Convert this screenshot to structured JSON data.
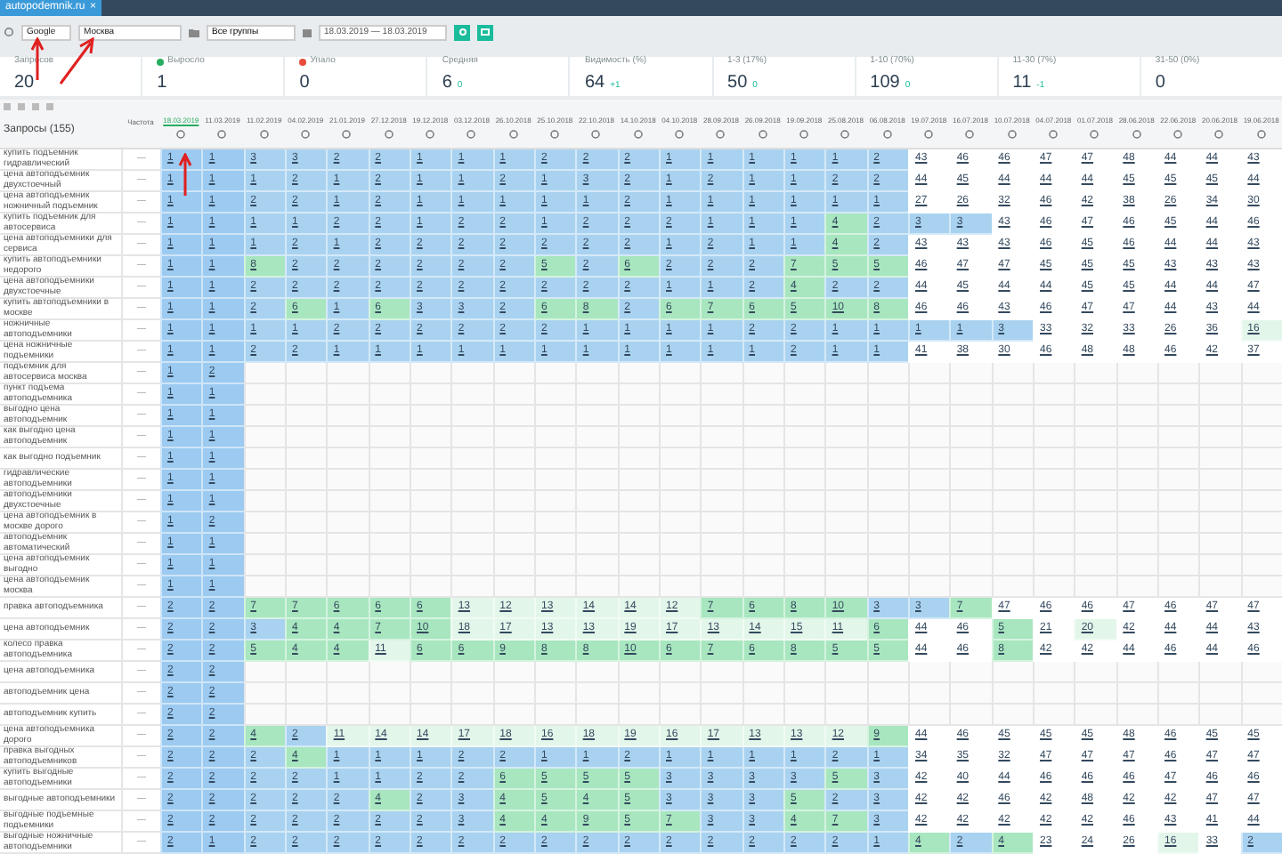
{
  "tab": {
    "label": "autopodemnik.ru",
    "close": "×"
  },
  "filters": {
    "engine": "Google",
    "region": "Москва",
    "group": "Все группы",
    "period": "18.03.2019 — 18.03.2019"
  },
  "stats": [
    {
      "label": "Запросов",
      "value": "20",
      "kind": "plain"
    },
    {
      "label": "Выросло",
      "value": "1",
      "kind": "up"
    },
    {
      "label": "Упало",
      "value": "0",
      "kind": "down"
    },
    {
      "label": "Средняя",
      "value": "6",
      "delta": "0",
      "kind": "metric"
    },
    {
      "label": "Видимость (%)",
      "value": "64",
      "delta": "+1",
      "kind": "metric"
    },
    {
      "label": "1-3 (17%)",
      "value": "50",
      "delta": "0",
      "kind": "metric"
    },
    {
      "label": "1-10 (70%)",
      "value": "109",
      "delta": "0",
      "kind": "metric"
    },
    {
      "label": "11-30 (7%)",
      "value": "11",
      "delta": "-1",
      "kind": "metric"
    },
    {
      "label": "31-50 (0%)",
      "value": "0",
      "kind": "plain"
    }
  ],
  "table": {
    "query_header": "Запросы (155)",
    "frequency_header": "Частота",
    "dates": [
      {
        "label": "18.03.2019",
        "current": true
      },
      {
        "label": "11.03.2019",
        "current": false
      },
      {
        "label": "11.02.2019",
        "current": false
      },
      {
        "label": "04.02.2019",
        "current": false
      },
      {
        "label": "21.01.2019",
        "current": false
      },
      {
        "label": "27.12.2018",
        "current": false
      },
      {
        "label": "19.12.2018",
        "current": false
      },
      {
        "label": "03.12.2018",
        "current": false
      },
      {
        "label": "26.10.2018",
        "current": false
      },
      {
        "label": "25.10.2018",
        "current": false
      },
      {
        "label": "22.10.2018",
        "current": false
      },
      {
        "label": "14.10.2018",
        "current": false
      },
      {
        "label": "04.10.2018",
        "current": false
      },
      {
        "label": "28.09.2018",
        "current": false
      },
      {
        "label": "26.09.2018",
        "current": false
      },
      {
        "label": "19.09.2018",
        "current": false
      },
      {
        "label": "25.08.2018",
        "current": false
      },
      {
        "label": "06.08.2018",
        "current": false
      },
      {
        "label": "19.07.2018",
        "current": false
      },
      {
        "label": "16.07.2018",
        "current": false
      },
      {
        "label": "10.07.2018",
        "current": false
      },
      {
        "label": "04.07.2018",
        "current": false
      },
      {
        "label": "01.07.2018",
        "current": false
      },
      {
        "label": "28.06.2018",
        "current": false
      },
      {
        "label": "22.06.2018",
        "current": false
      },
      {
        "label": "20.06.2018",
        "current": false
      },
      {
        "label": "19.06.2018",
        "current": false
      }
    ],
    "rows": [
      {
        "query": "купить подъемник гидравлический",
        "frequency": "—",
        "cells": [
          "1",
          "1",
          "3",
          "3",
          "2",
          "2",
          "1",
          "1",
          "1",
          "2",
          "2",
          "2",
          "1",
          "1",
          "1",
          "1",
          "1",
          "2",
          "43",
          "46",
          "46",
          "47",
          "47",
          "48",
          "44",
          "44",
          "43"
        ]
      },
      {
        "query": "цена автоподъемник двухстоечный",
        "frequency": "—",
        "cells": [
          "1",
          "1",
          "1",
          "2",
          "1",
          "2",
          "1",
          "1",
          "2",
          "1",
          "3",
          "2",
          "1",
          "2",
          "1",
          "1",
          "2",
          "2",
          "44",
          "45",
          "44",
          "44",
          "44",
          "45",
          "45",
          "45",
          "44"
        ]
      },
      {
        "query": "цена автоподъемник ножничный подъемник",
        "frequency": "—",
        "cells": [
          "1",
          "1",
          "2",
          "2",
          "1",
          "2",
          "1",
          "1",
          "1",
          "1",
          "1",
          "2",
          "1",
          "1",
          "1",
          "1",
          "1",
          "1",
          "27",
          "26",
          "32",
          "46",
          "42",
          "38",
          "26",
          "34",
          "30"
        ]
      },
      {
        "query": "купить подъемник для автосервиса",
        "frequency": "—",
        "cells": [
          "1",
          "1",
          "1",
          "1",
          "2",
          "2",
          "1",
          "2",
          "2",
          "1",
          "2",
          "2",
          "2",
          "1",
          "1",
          "1",
          "4",
          "2",
          "3",
          "3",
          "43",
          "46",
          "47",
          "46",
          "45",
          "44",
          "46"
        ]
      },
      {
        "query": "цена автоподъемники для сервиса",
        "frequency": "—",
        "cells": [
          "1",
          "1",
          "1",
          "2",
          "1",
          "2",
          "2",
          "2",
          "2",
          "2",
          "2",
          "2",
          "1",
          "2",
          "1",
          "1",
          "4",
          "2",
          "43",
          "43",
          "43",
          "46",
          "45",
          "46",
          "44",
          "44",
          "43"
        ]
      },
      {
        "query": "купить автоподъемники недорого",
        "frequency": "—",
        "cells": [
          "1",
          "1",
          "8",
          "2",
          "2",
          "2",
          "2",
          "2",
          "2",
          "5",
          "2",
          "6",
          "2",
          "2",
          "2",
          "7",
          "5",
          "5",
          "46",
          "47",
          "47",
          "45",
          "45",
          "45",
          "43",
          "43",
          "43"
        ]
      },
      {
        "query": "цена автоподъемники двухстоечные",
        "frequency": "—",
        "cells": [
          "1",
          "1",
          "2",
          "2",
          "2",
          "2",
          "2",
          "2",
          "2",
          "2",
          "2",
          "2",
          "1",
          "1",
          "2",
          "4",
          "2",
          "2",
          "44",
          "45",
          "44",
          "44",
          "45",
          "45",
          "44",
          "44",
          "47"
        ]
      },
      {
        "query": "купить автоподъемники в москве",
        "frequency": "—",
        "cells": [
          "1",
          "1",
          "2",
          "6",
          "1",
          "6",
          "3",
          "3",
          "2",
          "6",
          "8",
          "2",
          "6",
          "7",
          "6",
          "5",
          "10",
          "8",
          "46",
          "46",
          "43",
          "46",
          "47",
          "47",
          "44",
          "43",
          "44"
        ]
      },
      {
        "query": "ножничные автоподъемники",
        "frequency": "—",
        "cells": [
          "1",
          "1",
          "1",
          "1",
          "2",
          "2",
          "2",
          "2",
          "2",
          "2",
          "1",
          "1",
          "1",
          "1",
          "2",
          "2",
          "1",
          "1",
          "1",
          "1",
          "3",
          "33",
          "32",
          "33",
          "26",
          "36",
          "16"
        ]
      },
      {
        "query": "цена ножничные подъемники",
        "frequency": "—",
        "cells": [
          "1",
          "1",
          "2",
          "2",
          "1",
          "1",
          "1",
          "1",
          "1",
          "1",
          "1",
          "1",
          "1",
          "1",
          "1",
          "2",
          "1",
          "1",
          "41",
          "38",
          "30",
          "46",
          "48",
          "48",
          "46",
          "42",
          "37"
        ]
      },
      {
        "query": "подъемник для автосервиса москва",
        "frequency": "—",
        "cells": [
          "1",
          "2"
        ]
      },
      {
        "query": "пункт подъема автоподъемника",
        "frequency": "—",
        "cells": [
          "1",
          "1"
        ]
      },
      {
        "query": "выгодно цена автоподъемник",
        "frequency": "—",
        "cells": [
          "1",
          "1"
        ]
      },
      {
        "query": "как выгодно цена автоподъемник",
        "frequency": "—",
        "cells": [
          "1",
          "1"
        ]
      },
      {
        "query": "как выгодно подъемник",
        "frequency": "—",
        "cells": [
          "1",
          "1"
        ]
      },
      {
        "query": "гидравлические автоподъемники",
        "frequency": "—",
        "cells": [
          "1",
          "1"
        ]
      },
      {
        "query": "автоподъемники двухстоечные",
        "frequency": "—",
        "cells": [
          "1",
          "1"
        ]
      },
      {
        "query": "цена автоподъемник в москве дорого",
        "frequency": "—",
        "cells": [
          "1",
          "2"
        ]
      },
      {
        "query": "автоподъемник автоматический",
        "frequency": "—",
        "cells": [
          "1",
          "1"
        ]
      },
      {
        "query": "цена автоподъемник выгодно",
        "frequency": "—",
        "cells": [
          "1",
          "1"
        ]
      },
      {
        "query": "цена автоподъемник москва",
        "frequency": "—",
        "cells": [
          "1",
          "1"
        ]
      },
      {
        "query": "правка автоподъемника",
        "frequency": "—",
        "cells": [
          "2",
          "2",
          "7",
          "7",
          "6",
          "6",
          "6",
          "13",
          "12",
          "13",
          "14",
          "14",
          "12",
          "7",
          "6",
          "8",
          "10",
          "3",
          "3",
          "7",
          "47",
          "46",
          "46",
          "47",
          "46",
          "47",
          "47"
        ]
      },
      {
        "query": "цена автоподъемник",
        "frequency": "—",
        "cells": [
          "2",
          "2",
          "3",
          "4",
          "4",
          "7",
          "10",
          "18",
          "17",
          "13",
          "13",
          "19",
          "17",
          "13",
          "14",
          "15",
          "11",
          "6",
          "44",
          "46",
          "5",
          "21",
          "20",
          "42",
          "44",
          "44",
          "43"
        ]
      },
      {
        "query": "колесо правка автоподъемника",
        "frequency": "—",
        "cells": [
          "2",
          "2",
          "5",
          "4",
          "4",
          "11",
          "6",
          "6",
          "9",
          "8",
          "8",
          "10",
          "6",
          "7",
          "6",
          "8",
          "5",
          "5",
          "44",
          "46",
          "8",
          "42",
          "42",
          "44",
          "46",
          "44",
          "46"
        ]
      },
      {
        "query": "цена автоподъемника",
        "frequency": "—",
        "cells": [
          "2",
          "2"
        ]
      },
      {
        "query": "автоподъемник цена",
        "frequency": "—",
        "cells": [
          "2",
          "2"
        ]
      },
      {
        "query": "автоподъемник купить",
        "frequency": "—",
        "cells": [
          "2",
          "2"
        ]
      },
      {
        "query": "цена автоподъемника дорого",
        "frequency": "—",
        "cells": [
          "2",
          "2",
          "4",
          "2",
          "11",
          "14",
          "14",
          "17",
          "18",
          "16",
          "18",
          "19",
          "16",
          "17",
          "13",
          "13",
          "12",
          "9",
          "44",
          "46",
          "45",
          "45",
          "45",
          "48",
          "46",
          "45",
          "45"
        ]
      },
      {
        "query": "правка выгодных автоподъемников",
        "frequency": "—",
        "cells": [
          "2",
          "2",
          "2",
          "4",
          "1",
          "1",
          "1",
          "2",
          "2",
          "1",
          "1",
          "2",
          "1",
          "1",
          "1",
          "1",
          "2",
          "1",
          "34",
          "35",
          "32",
          "47",
          "47",
          "47",
          "46",
          "47",
          "47"
        ]
      },
      {
        "query": "купить выгодные автоподъемники",
        "frequency": "—",
        "cells": [
          "2",
          "2",
          "2",
          "2",
          "1",
          "1",
          "2",
          "2",
          "6",
          "5",
          "5",
          "5",
          "3",
          "3",
          "3",
          "3",
          "5",
          "3",
          "42",
          "40",
          "44",
          "46",
          "46",
          "46",
          "47",
          "46",
          "46"
        ]
      },
      {
        "query": "выгодные автоподъемники",
        "frequency": "—",
        "cells": [
          "2",
          "2",
          "2",
          "2",
          "2",
          "4",
          "2",
          "3",
          "4",
          "5",
          "4",
          "5",
          "3",
          "3",
          "3",
          "5",
          "2",
          "3",
          "42",
          "42",
          "46",
          "42",
          "48",
          "42",
          "42",
          "47",
          "47"
        ]
      },
      {
        "query": "выгодные подъемные подъемники",
        "frequency": "—",
        "cells": [
          "2",
          "2",
          "2",
          "2",
          "2",
          "2",
          "2",
          "3",
          "4",
          "4",
          "9",
          "5",
          "7",
          "3",
          "3",
          "4",
          "7",
          "3",
          "42",
          "42",
          "42",
          "42",
          "42",
          "46",
          "43",
          "41",
          "44"
        ]
      },
      {
        "query": "выгодные ножничные автоподъемники",
        "frequency": "—",
        "cells": [
          "2",
          "1",
          "2",
          "2",
          "2",
          "2",
          "2",
          "2",
          "2",
          "2",
          "2",
          "2",
          "2",
          "2",
          "2",
          "2",
          "2",
          "1",
          "4",
          "2",
          "4",
          "23",
          "24",
          "26",
          "16",
          "33",
          "2"
        ]
      }
    ]
  }
}
